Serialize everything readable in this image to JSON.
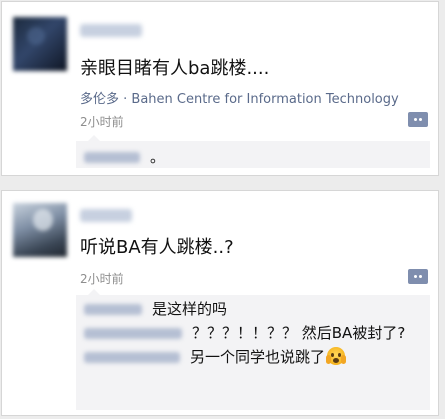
{
  "post1": {
    "text": "亲眼目睹有人ba跳楼....",
    "location": "多伦多 · Bahen Centre for Information Technology",
    "time": "2小时前",
    "comments": [
      {
        "text": "。"
      }
    ]
  },
  "post2": {
    "text": "听说BA有人跳楼..?",
    "time": "2小时前",
    "comments": [
      {
        "text": "是这样的吗"
      },
      {
        "text": "？？？！！？？ 然后BA被封了?"
      },
      {
        "text": "另一个同学也说跳了"
      }
    ]
  },
  "icons": {
    "comment": "comment-bubble-icon",
    "emoji": "fearful-face-emoji"
  },
  "colors": {
    "location": "#5a6a8a",
    "comment_button": "#7f8eae",
    "comment_bg": "#f3f3f5"
  }
}
